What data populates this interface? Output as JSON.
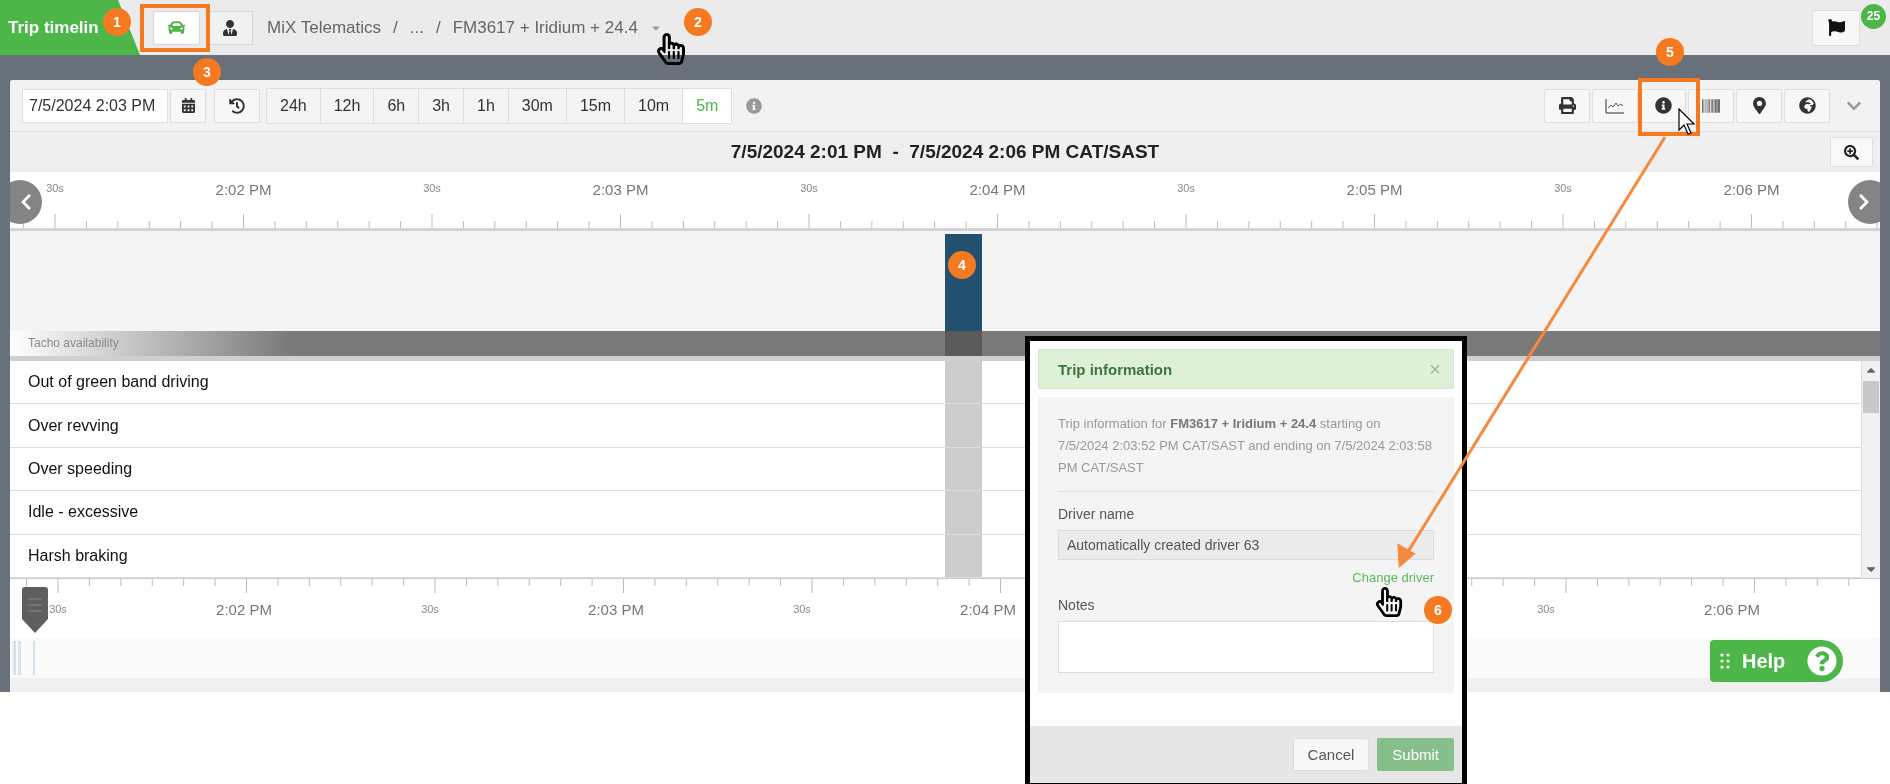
{
  "header": {
    "tab_title": "Trip timelin",
    "mode_buttons": [
      {
        "kind": "vehicle",
        "selected": true
      },
      {
        "kind": "driver",
        "selected": false
      }
    ],
    "breadcrumb": [
      "MiX Telematics",
      "/",
      "...",
      "/",
      "FM3617 + Iridium + 24.4"
    ],
    "notification_count": "25"
  },
  "toolbar": {
    "date": "7/5/2024 2:03 PM",
    "ranges": [
      {
        "label": "24h",
        "selected": false
      },
      {
        "label": "12h",
        "selected": false
      },
      {
        "label": "6h",
        "selected": false
      },
      {
        "label": "3h",
        "selected": false
      },
      {
        "label": "1h",
        "selected": false
      },
      {
        "label": "30m",
        "selected": false
      },
      {
        "label": "15m",
        "selected": false
      },
      {
        "label": "10m",
        "selected": false
      },
      {
        "label": "5m",
        "selected": true
      }
    ]
  },
  "range_title": "7/5/2024 2:01 PM  -  7/5/2024 2:06 PM CAT/SAST",
  "timeline": {
    "top_ruler": [
      {
        "label": "30s",
        "kind": "minor"
      },
      {
        "label": "2:02 PM",
        "kind": "major"
      },
      {
        "label": "30s",
        "kind": "minor"
      },
      {
        "label": "2:03 PM",
        "kind": "major"
      },
      {
        "label": "30s",
        "kind": "minor"
      },
      {
        "label": "2:04 PM",
        "kind": "major"
      },
      {
        "label": "30s",
        "kind": "minor"
      },
      {
        "label": "2:05 PM",
        "kind": "major"
      },
      {
        "label": "30s",
        "kind": "minor"
      },
      {
        "label": "2:06 PM",
        "kind": "major"
      }
    ],
    "bottom_ruler_left": [
      {
        "label": "30s",
        "kind": "minor"
      },
      {
        "label": "2:02 PM",
        "kind": "major"
      },
      {
        "label": "30s",
        "kind": "minor"
      },
      {
        "label": "2:03 PM",
        "kind": "major"
      },
      {
        "label": "30s",
        "kind": "minor"
      },
      {
        "label": "2:04 PM",
        "kind": "major"
      }
    ],
    "bottom_ruler_right": [
      {
        "label": "30s",
        "kind": "minor"
      },
      {
        "label": "2:06 PM",
        "kind": "major"
      }
    ],
    "band_label": "Tacho availability",
    "event_rows": [
      "Out of green band driving",
      "Over revving",
      "Over speeding",
      "Idle - excessive",
      "Harsh braking"
    ]
  },
  "trip_dialog": {
    "title": "Trip information",
    "close": "×",
    "description": "Trip information for **FM3617 + Iridium + 24.4** starting on 7/5/2024 2:03:52 PM CAT/SAST and ending on 7/5/2024 2:03:58 PM CAT/SAST",
    "driver_label": "Driver name",
    "driver_value": "Automatically created driver 63",
    "change_link": "Change driver",
    "notes_label": "Notes",
    "buttons": [
      {
        "label": "Cancel",
        "kind": "secondary",
        "disabled": false
      },
      {
        "label": "Submit",
        "kind": "primary",
        "disabled": true
      }
    ]
  },
  "help_button": {
    "label": "Help"
  },
  "annotations": [
    "1",
    "2",
    "3",
    "4",
    "5",
    "6"
  ]
}
